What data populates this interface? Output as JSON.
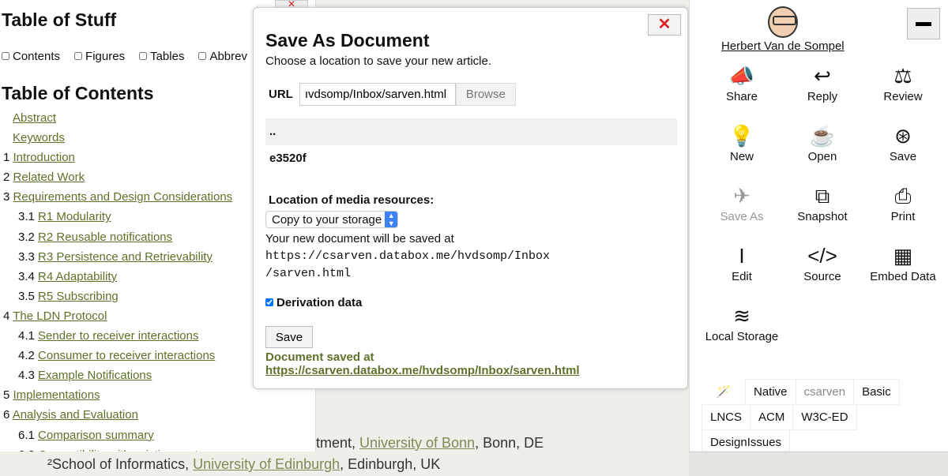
{
  "left": {
    "title": "Table of Stuff",
    "checkboxes": [
      "Contents",
      "Figures",
      "Tables",
      "Abbrev"
    ],
    "toc_title": "Table of Contents",
    "toc": [
      {
        "num": "",
        "label": "Abstract",
        "level": "x"
      },
      {
        "num": "",
        "label": "Keywords",
        "level": "x"
      },
      {
        "num": "1",
        "label": "Introduction",
        "level": "0"
      },
      {
        "num": "2",
        "label": "Related Work",
        "level": "0"
      },
      {
        "num": "3",
        "label": "Requirements and Design Considerations",
        "level": "0"
      },
      {
        "num": "3.1",
        "label": "R1 Modularity",
        "level": "1"
      },
      {
        "num": "3.2",
        "label": "R2 Reusable notifications",
        "level": "1"
      },
      {
        "num": "3.3",
        "label": "R3 Persistence and Retrievability",
        "level": "1"
      },
      {
        "num": "3.4",
        "label": "R4 Adaptability",
        "level": "1"
      },
      {
        "num": "3.5",
        "label": "R5 Subscribing",
        "level": "1"
      },
      {
        "num": "4",
        "label": "The LDN Protocol",
        "level": "0"
      },
      {
        "num": "4.1",
        "label": "Sender to receiver interactions",
        "level": "1"
      },
      {
        "num": "4.2",
        "label": "Consumer to receiver interactions",
        "level": "1"
      },
      {
        "num": "4.3",
        "label": "Example Notifications",
        "level": "1"
      },
      {
        "num": "5",
        "label": "Implementations",
        "level": "0"
      },
      {
        "num": "6",
        "label": "Analysis and Evaluation",
        "level": "0"
      },
      {
        "num": "6.1",
        "label": "Comparison summary",
        "level": "1"
      },
      {
        "num": "6.2",
        "label": "Compatibility with existing systems",
        "level": "1"
      }
    ]
  },
  "background": {
    "line1_pre": "tment, ",
    "line1_link": "University of Bonn",
    "line1_post": ", Bonn, DE",
    "line2_pre": "²School of Informatics, ",
    "line2_link": "University of Edinburgh",
    "line2_post": ", Edinburgh, UK"
  },
  "modal": {
    "close": "✕",
    "title": "Save As Document",
    "subtitle": "Choose a location to save your new article.",
    "url_label": "URL",
    "url_value": "ıvdsomp/Inbox/sarven.html",
    "browse": "Browse",
    "dirs": [
      "..",
      "e3520f"
    ],
    "media_label": "Location of media resources:",
    "media_option": "Copy to your storage",
    "saved_at_text": "Your new document will be saved at",
    "saved_at_url1": "https://csarven.databox.me/hvdsomp/Inbox",
    "saved_at_url2": "/sarven.html",
    "derivation": "Derivation data",
    "derivation_checked": true,
    "save": "Save",
    "msg_pre": "Document saved at ",
    "msg_link": "https://csarven.databox.me/hvdsomp/Inbox/sarven.html"
  },
  "right": {
    "user": "Herbert Van de Sompel",
    "actions": [
      {
        "label": "Share",
        "icon": "📣"
      },
      {
        "label": "Reply",
        "icon": "↩"
      },
      {
        "label": "Review",
        "icon": "⚖"
      },
      {
        "label": "New",
        "icon": "💡"
      },
      {
        "label": "Open",
        "icon": "☕"
      },
      {
        "label": "Save",
        "icon": "⊛"
      },
      {
        "label": "Save As",
        "icon": "✈",
        "disabled": true
      },
      {
        "label": "Snapshot",
        "icon": "⧉"
      },
      {
        "label": "Print",
        "icon": "⎙"
      },
      {
        "label": "Edit",
        "icon": "I"
      },
      {
        "label": "Source",
        "icon": "</>"
      },
      {
        "label": "Embed Data",
        "icon": "▦"
      },
      {
        "label": "Local Storage",
        "icon": "≋"
      }
    ],
    "styles": [
      "Native",
      "csarven",
      "Basic",
      "LNCS",
      "ACM",
      "W3C-ED",
      "DesignIssues"
    ],
    "current_style": "csarven"
  },
  "colors": {
    "link": "#5f7129",
    "close": "#dd2222"
  }
}
